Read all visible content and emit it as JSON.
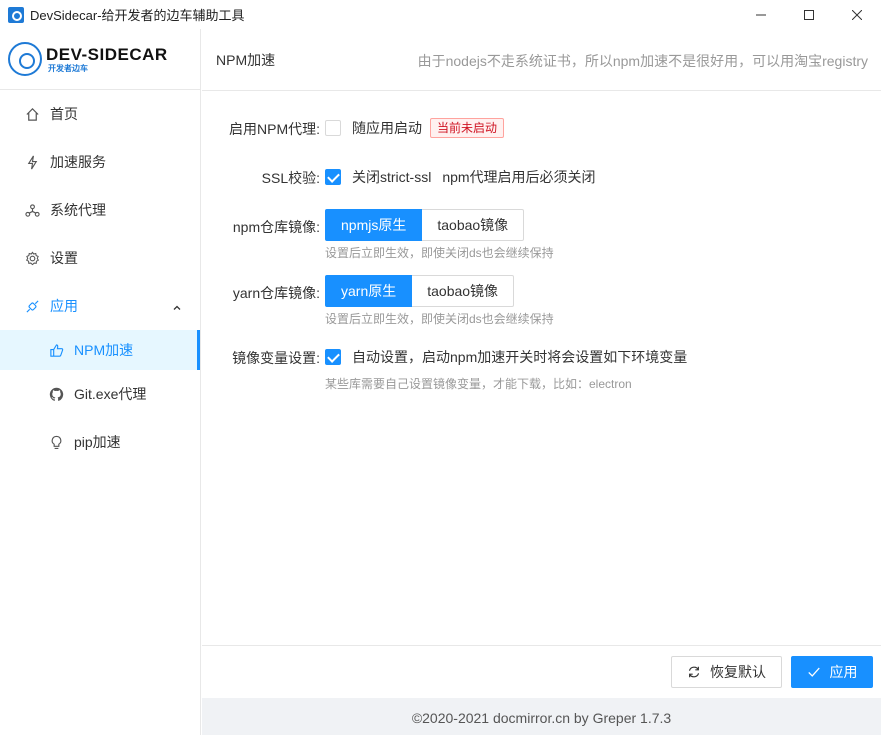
{
  "window": {
    "title": "DevSidecar-给开发者的边车辅助工具",
    "app_icon": "dev-sidecar-app-icon",
    "controls": [
      "minimize-icon",
      "maximize-icon",
      "close-icon"
    ]
  },
  "logo": {
    "main": "DEV-SIDECAR",
    "sub": "开发者边车"
  },
  "sidebar": {
    "items": [
      {
        "label": "首页",
        "icon": "home-icon"
      },
      {
        "label": "加速服务",
        "icon": "thunderbolt-icon"
      },
      {
        "label": "系统代理",
        "icon": "cluster-icon"
      },
      {
        "label": "设置",
        "icon": "setting-icon"
      },
      {
        "label": "应用",
        "icon": "api-icon",
        "expanded": true
      }
    ],
    "sub_items": [
      {
        "label": "NPM加速",
        "icon": "like-icon",
        "active": true
      },
      {
        "label": "Git.exe代理",
        "icon": "github-icon"
      },
      {
        "label": "pip加速",
        "icon": "bulb-icon"
      }
    ]
  },
  "header": {
    "title": "NPM加速",
    "tip": "由于nodejs不走系统证书，所以npm加速不是很好用，可以用淘宝registry"
  },
  "form": {
    "enable": {
      "label": "启用NPM代理:",
      "checkbox_label": "随应用启动",
      "checked": false,
      "status_tag": "当前未启动",
      "status_color": "#cf1322"
    },
    "ssl": {
      "label": "SSL校验:",
      "checkbox_label": "关闭strict-ssl",
      "checked": true,
      "extra": "npm代理启用后必须关闭"
    },
    "npm_registry": {
      "label": "npm仓库镜像:",
      "options": [
        "npmjs原生",
        "taobao镜像"
      ],
      "selected": "npmjs原生",
      "help": "设置后立即生效，即使关闭ds也会继续保持"
    },
    "yarn_registry": {
      "label": "yarn仓库镜像:",
      "options": [
        "yarn原生",
        "taobao镜像"
      ],
      "selected": "yarn原生",
      "help": "设置后立即生效，即使关闭ds也会继续保持"
    },
    "env": {
      "label": "镜像变量设置:",
      "checkbox_label": "自动设置，启动npm加速开关时将会设置如下环境变量",
      "checked": true,
      "help": "某些库需要自己设置镜像变量，才能下载，比如：electron"
    }
  },
  "actions": {
    "reset_label": "恢复默认",
    "reset_icon": "sync-icon",
    "apply_label": "应用",
    "apply_icon": "check-icon"
  },
  "footer": {
    "copyright": "©2020-2021 docmirror.cn by Greper 1.7.3"
  },
  "colors": {
    "primary": "#1890ff",
    "tag_bg": "#fff1f0",
    "footer_bg": "#f0f2f5"
  }
}
